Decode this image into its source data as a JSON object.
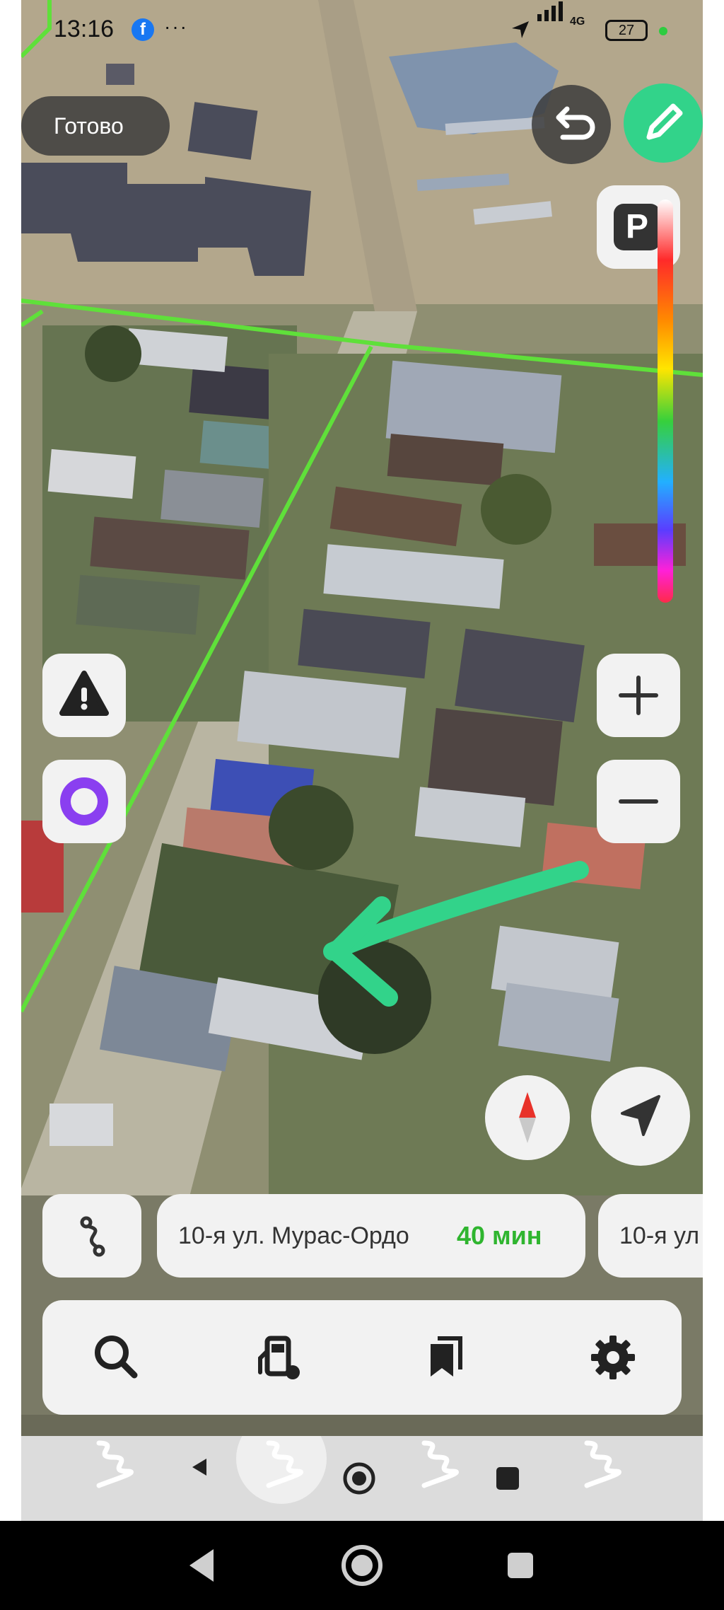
{
  "status_bar": {
    "time": "13:16",
    "more": "···",
    "network_type": "4G",
    "battery_level": "27",
    "notification_app_icon": "facebook-icon"
  },
  "top_controls": {
    "done_label": "Готово",
    "undo_icon": "undo-icon",
    "edit_icon": "pencil-icon",
    "parking_label": "P"
  },
  "side_controls": {
    "alert_icon": "warning-icon",
    "assistant_icon": "alice-assistant-icon",
    "zoom_in_icon": "plus-icon",
    "zoom_out_icon": "minus-icon",
    "compass_icon": "compass-icon",
    "locate_icon": "navigation-arrow-icon"
  },
  "routes": [
    {
      "name": "10-я ул. Мурас-Ордо",
      "time": "40 мин"
    },
    {
      "name": "10-я ул"
    }
  ],
  "toolbar": {
    "items": [
      {
        "icon": "search-icon"
      },
      {
        "icon": "gas-station-icon"
      },
      {
        "icon": "bookmarks-icon"
      },
      {
        "icon": "settings-gear-icon"
      }
    ]
  },
  "annotation": {
    "color": "#32d38a",
    "icon": "green-arrow-annotation"
  },
  "colors": {
    "accent_green": "#32d38a",
    "route_time_green": "#2fb52f",
    "road_highlight": "#5fe03a"
  }
}
